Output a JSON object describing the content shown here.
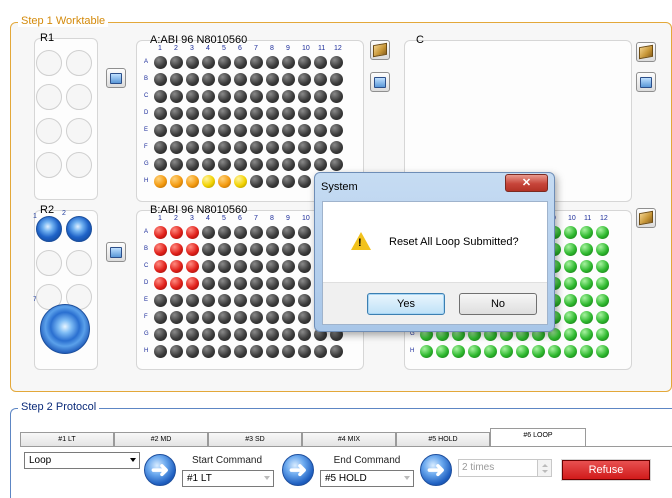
{
  "step1": {
    "legend": "Step 1 Worktable",
    "r1_label": "R1",
    "r2_label": "R2",
    "r2_well_numbers": [
      "1",
      "2",
      "7"
    ],
    "plate_a_label": "A:ABI 96 N8010560",
    "plate_b_label": "B:ABI 96 N8010560",
    "plate_c_label": "C",
    "col_numbers": [
      "1",
      "2",
      "3",
      "4",
      "5",
      "6",
      "7",
      "8",
      "9",
      "10",
      "11",
      "12"
    ],
    "row_letters": [
      "A",
      "B",
      "C",
      "D",
      "E",
      "F",
      "G",
      "H"
    ],
    "plate_d_col_numbers": [
      "9",
      "10",
      "11",
      "12"
    ],
    "well_state_colors": {
      "empty": "#2a2a2a",
      "red": "#e0201a",
      "green": "#2eb82e",
      "orange": "#f39a10",
      "yellow": "#f2d200",
      "reagent_blue": "#1f63c8"
    },
    "plate_a_highlight_row": "H",
    "plate_a_highlight_wells": [
      "orange",
      "orange",
      "orange",
      "yellow",
      "orange",
      "yellow"
    ],
    "plate_b_red_wells": {
      "A": 3,
      "B": 3,
      "C": 3,
      "D": 3
    },
    "plate_d_green_rows": [
      "A",
      "B",
      "C",
      "D",
      "E",
      "F",
      "G",
      "H"
    ],
    "icons": [
      "screen-icon",
      "plate-box-icon"
    ]
  },
  "dialog": {
    "title": "System",
    "close_label": "✕",
    "message": "Reset All Loop Submitted?",
    "yes_label": "Yes",
    "no_label": "No",
    "icon": "warning-icon"
  },
  "step2": {
    "legend": "Step 2 Protocol",
    "tabs": [
      "#1 LT",
      "#2 MD",
      "#3 SD",
      "#4 MIX",
      "#5 HOLD",
      "#6 LOOP"
    ],
    "active_tab": "#6 LOOP",
    "mode_value": "Loop",
    "start_label": "Start Command",
    "start_value": "#1 LT",
    "end_label": "End Command",
    "end_value": "#5 HOLD",
    "times_value": "2 times",
    "refuse_label": "Refuse"
  }
}
